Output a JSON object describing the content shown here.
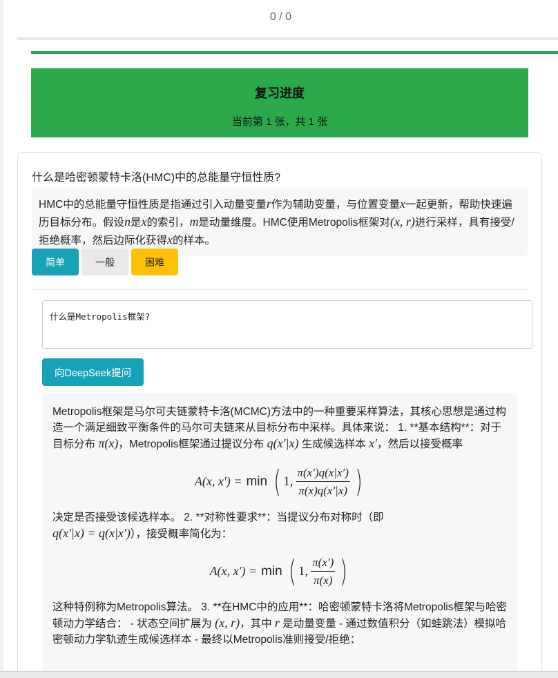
{
  "header": {
    "counter": "0 / 0"
  },
  "review": {
    "title": "复习进度",
    "subtitle": "当前第 1 张，共 1 张"
  },
  "card": {
    "question": "什么是哈密顿蒙特卡洛(HMC)中的总能量守恒性质?",
    "answer": {
      "p1": "HMC中的总能量守恒性质是指通过引入动量变量",
      "v_r": "r",
      "p2": "作为辅助变量，与位置变量",
      "v_x": "x",
      "p3": "一起更新，帮助快速遍历目标分布。假设",
      "v_n": "n",
      "p4": "是",
      "v_x2": "x",
      "p5": "的索引，",
      "v_m": "m",
      "p6": "是动量维度。HMC使用Metropolis框架对",
      "v_xr": "(x, r)",
      "p7": "进行采样，具有接受/拒绝概率，然后边际化获得",
      "v_x3": "x",
      "p8": "的样本。"
    },
    "buttons": {
      "easy": "简单",
      "normal": "一般",
      "hard": "困难"
    }
  },
  "ask": {
    "input_value": "什么是Metropolis框架?",
    "button_label": "向DeepSeek提问"
  },
  "response": {
    "para1": {
      "t1": "Metropolis框架是马尔可夫链蒙特卡洛(MCMC)方法中的一种重要采样算法，其核心思想是通过构造一个满足细致平衡条件的马尔可夫链来从目标分布中采样。具体来说： 1. **基本结构**：对于目标分布 ",
      "m1": "π(x)",
      "t2": "，Metropolis框架通过提议分布 ",
      "m2": "q(x′|x)",
      "t3": " 生成候选样本 ",
      "m3": "x′",
      "t4": "，然后以接受概率"
    },
    "formula1": {
      "lhs": "A(x, x′) =",
      "fn": "min",
      "one": "1,",
      "num": "π(x′)q(x|x′)",
      "den": "π(x)q(x′|x)"
    },
    "para2": {
      "t1": "决定是否接受该候选样本。 2. **对称性要求**：当提议分布对称时（即",
      "m1": "q(x′|x) = q(x|x′)",
      "t2": "），接受概率简化为："
    },
    "formula2": {
      "lhs": "A(x, x′) =",
      "fn": "min",
      "one": "1,",
      "num": "π(x′)",
      "den": "π(x)"
    },
    "para3": {
      "t1": "这种特例称为Metropolis算法。 3. **在HMC中的应用**：哈密顿蒙特卡洛将Metropolis框架与哈密顿动力学结合： - 状态空间扩展为 ",
      "m1": "(x, r)",
      "t2": "，其中 ",
      "m2": "r",
      "t3": " 是动量变量 - 通过数值积分（如蛙跳法）模拟哈密顿动力学轨迹生成候选样本 - 最终以Metropolis准则接受/拒绝："
    }
  },
  "colors": {
    "green": "#28a745",
    "teal": "#17a2b8",
    "yellow": "#ffc107"
  }
}
